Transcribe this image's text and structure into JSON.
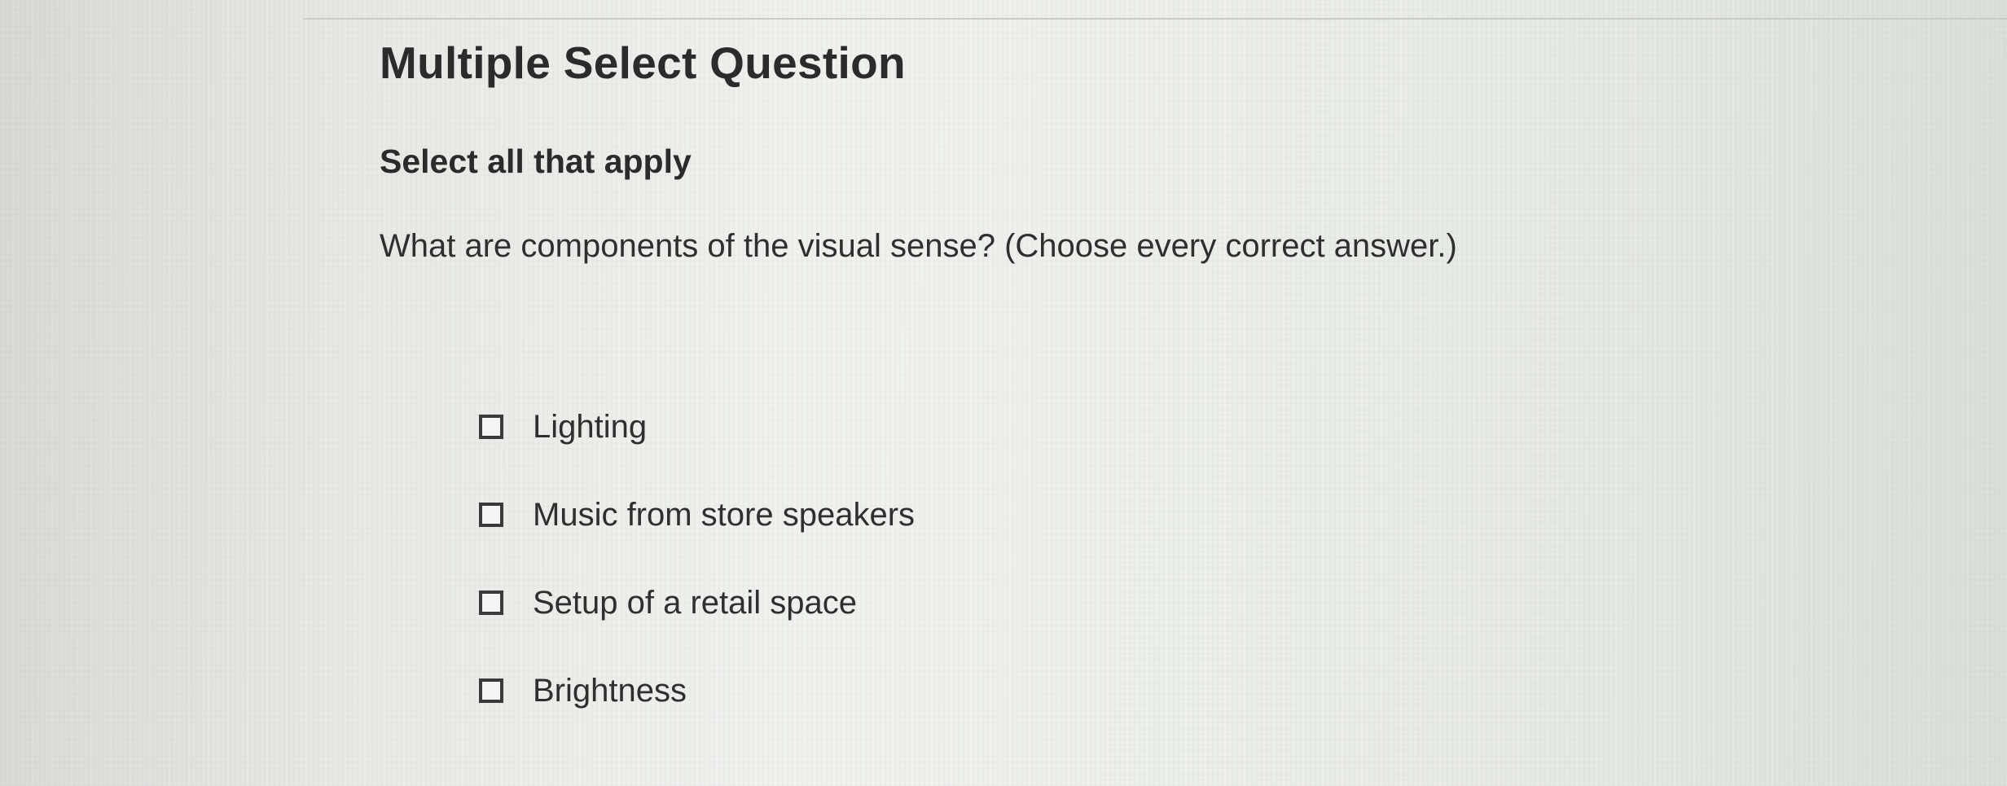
{
  "question": {
    "type_heading": "Multiple Select Question",
    "instruction": "Select all that apply",
    "prompt": "What are components of the visual sense? (Choose every correct answer.)",
    "options": [
      {
        "label": "Lighting",
        "checked": false
      },
      {
        "label": "Music from store speakers",
        "checked": false
      },
      {
        "label": "Setup of a retail space",
        "checked": false
      },
      {
        "label": "Brightness",
        "checked": false
      }
    ]
  }
}
